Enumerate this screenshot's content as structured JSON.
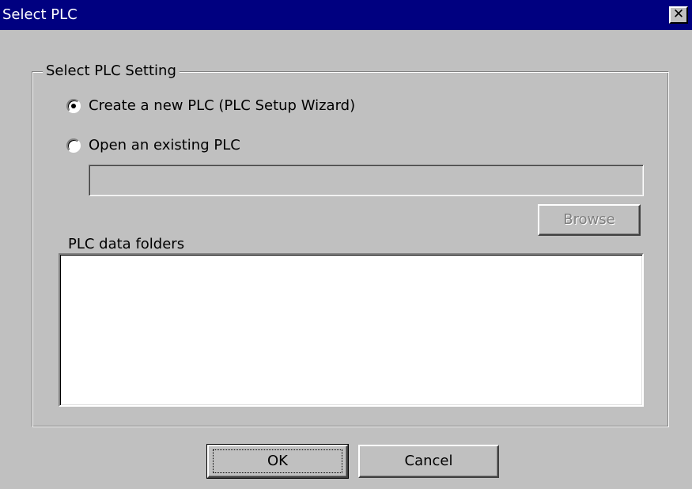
{
  "window": {
    "title": "Select PLC",
    "close_glyph": "✕",
    "close_icon": "close-icon"
  },
  "group": {
    "label": "Select PLC Setting"
  },
  "options": {
    "create_label": "Create a new PLC (PLC Setup Wizard)",
    "create_selected": true,
    "open_label": "Open an existing PLC",
    "open_selected": false
  },
  "path_field": {
    "value": "",
    "enabled": false
  },
  "browse": {
    "label": "Browse",
    "enabled": false
  },
  "folders": {
    "label": "PLC data folders",
    "items": []
  },
  "buttons": {
    "ok_label": "OK",
    "cancel_label": "Cancel"
  },
  "colors": {
    "titlebar": "#000080",
    "face": "#c0c0c0",
    "disabled_text": "#808080"
  }
}
